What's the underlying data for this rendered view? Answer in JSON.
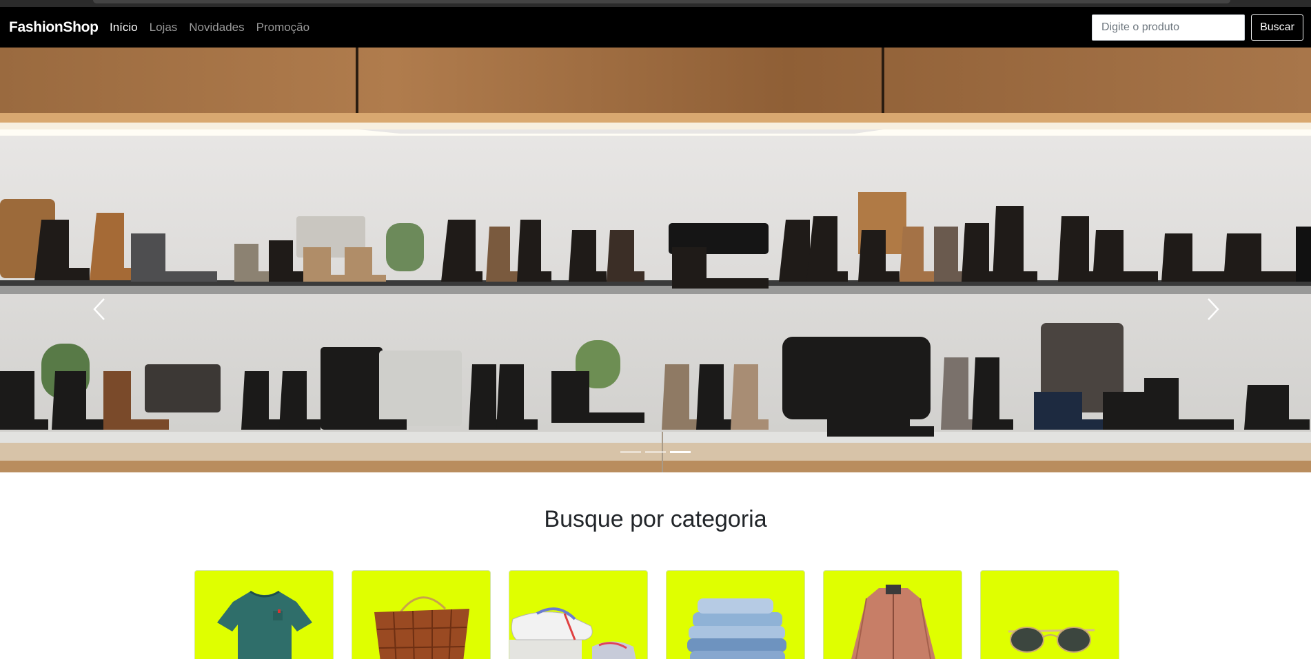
{
  "navbar": {
    "brand": "FashionShop",
    "links": [
      "Início",
      "Lojas",
      "Novidades",
      "Promoção"
    ],
    "active_index": 0,
    "search_placeholder": "Digite o produto",
    "search_button": "Buscar"
  },
  "carousel": {
    "slide_count": 3,
    "active_slide": 3
  },
  "categories_section": {
    "title": "Busque por categoria",
    "items": [
      {
        "icon": "tshirt-icon"
      },
      {
        "icon": "bag-icon"
      },
      {
        "icon": "sneaker-icon"
      },
      {
        "icon": "jeans-icon"
      },
      {
        "icon": "jacket-icon"
      },
      {
        "icon": "sunglasses-icon"
      }
    ]
  },
  "colors": {
    "navbar_bg": "#000000",
    "category_bg": "#dfff00"
  }
}
